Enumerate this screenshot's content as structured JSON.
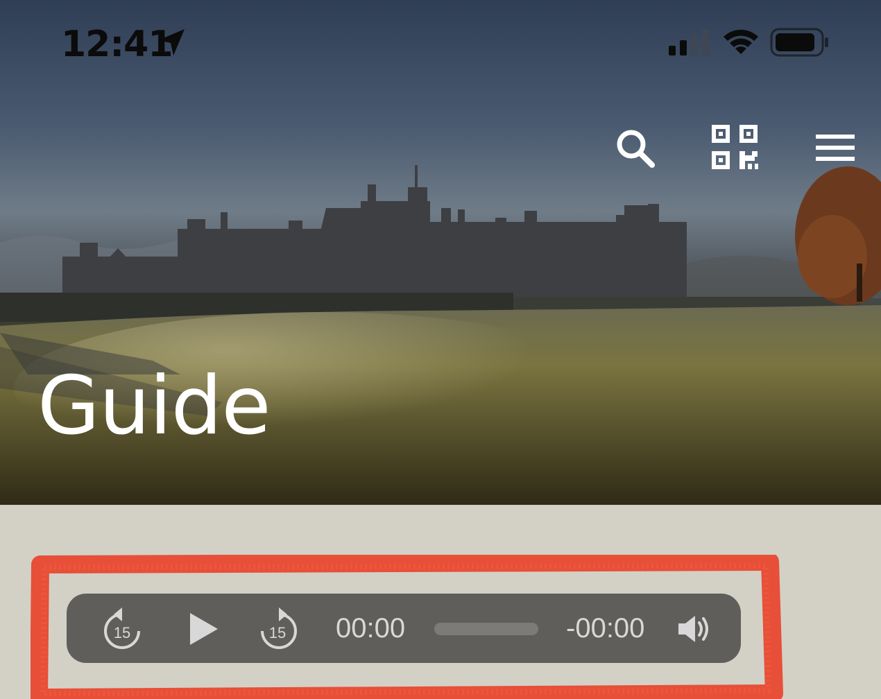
{
  "status_bar": {
    "time": "12:41",
    "icons": [
      "location-arrow-icon",
      "cellular-signal-icon",
      "wifi-icon",
      "battery-icon"
    ]
  },
  "header": {
    "title": "Guide",
    "actions": [
      "search-icon",
      "qr-code-icon",
      "hamburger-menu-icon"
    ]
  },
  "audio_player": {
    "elapsed": "00:00",
    "remaining": "-00:00",
    "progress_percent": 0,
    "skip_back_seconds": "15",
    "skip_forward_seconds": "15",
    "controls": [
      "rewind-15-icon",
      "play-icon",
      "forward-15-icon",
      "volume-icon"
    ]
  },
  "colors": {
    "page_background": "#d3d1c6",
    "player_background": "#5f5e5a",
    "player_text": "#d8d8d8",
    "annotation_stroke": "#e8432c"
  }
}
